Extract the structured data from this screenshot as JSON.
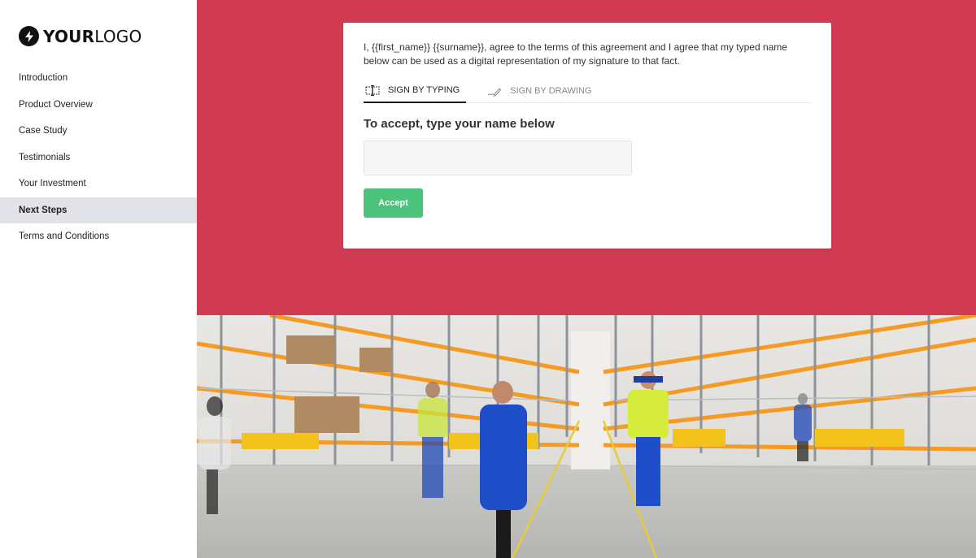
{
  "brand": {
    "logo_bold": "YOUR",
    "logo_light": "LOGO",
    "logo_icon": "lightning-bolt-icon"
  },
  "sidebar": {
    "items": [
      {
        "label": "Introduction",
        "active": false
      },
      {
        "label": "Product Overview",
        "active": false
      },
      {
        "label": "Case Study",
        "active": false
      },
      {
        "label": "Testimonials",
        "active": false
      },
      {
        "label": "Your Investment",
        "active": false
      },
      {
        "label": "Next Steps",
        "active": true
      },
      {
        "label": "Terms and Conditions",
        "active": false
      }
    ]
  },
  "signature": {
    "agreement_text": "I, {{first_name}} {{surname}}, agree to the terms of this agreement and I agree that my typed name below can be used as a digital representation of my signature to that fact.",
    "tabs": [
      {
        "label": "SIGN BY TYPING",
        "icon": "text-cursor-box-icon",
        "active": true
      },
      {
        "label": "SIGN BY DRAWING",
        "icon": "signature-pen-icon",
        "active": false
      }
    ],
    "heading": "To accept, type your name below",
    "name_value": "",
    "name_placeholder": "",
    "accept_label": "Accept"
  },
  "colors": {
    "hero_background": "#d13b52",
    "accept_button": "#4cc37a",
    "active_nav_background": "#e1e3e9"
  },
  "image": {
    "description": "Warehouse aisle with orange pallet racking and workers in blue uniforms walking"
  }
}
